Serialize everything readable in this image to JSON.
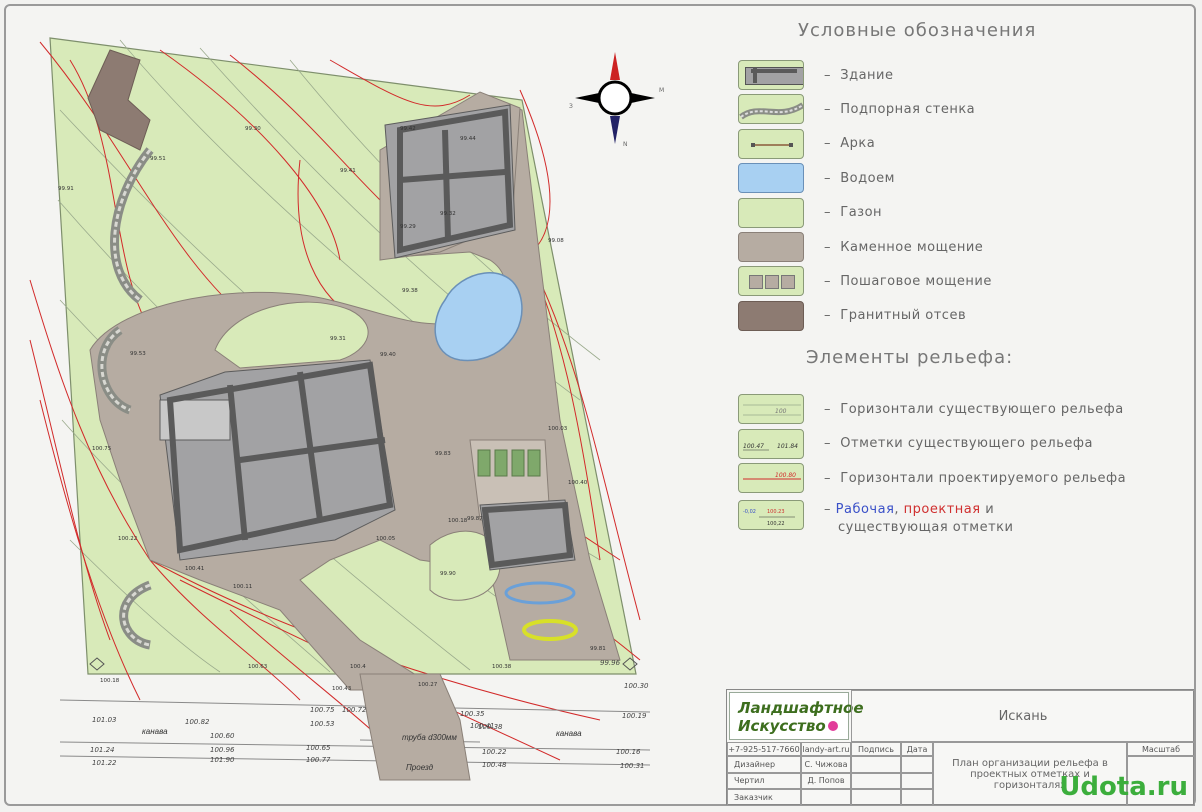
{
  "legend": {
    "title": "Условные обозначения",
    "items": [
      {
        "label": "Здание",
        "swatch": "building"
      },
      {
        "label": "Подпорная стенка",
        "swatch": "wall"
      },
      {
        "label": "Арка",
        "swatch": "arch"
      },
      {
        "label": "Водоем",
        "swatch": "pond"
      },
      {
        "label": "Газон",
        "swatch": "lawn"
      },
      {
        "label": "Каменное мощение",
        "swatch": "stone"
      },
      {
        "label": "Пошаговое мощение",
        "swatch": "steps"
      },
      {
        "label": "Гранитный отсев",
        "swatch": "granite"
      }
    ]
  },
  "relief": {
    "title": "Элементы рельефа:",
    "items": [
      {
        "label": "Горизонтали существующего рельефа",
        "swatch_text": "100"
      },
      {
        "label": "Отметки существующего рельефа",
        "swatch_text_left": "100.47",
        "swatch_text_right": "101.84"
      },
      {
        "label": "Горизонтали проектируемого рельефа",
        "swatch_text": "100.80"
      }
    ],
    "last": {
      "blue": "Рабочая",
      "sep1": ",",
      "red": "проектная",
      "sep2": "и",
      "line2": "существующая отметки",
      "swatch_work": "-0,02",
      "swatch_proj": "100.23",
      "swatch_exist": "100,22"
    }
  },
  "compass": {
    "e": "M",
    "w": "З",
    "s": "N"
  },
  "plan_labels": {
    "kanava_left": "канава",
    "kanava_right": "канава",
    "truba": "труба d300мм",
    "proezd": "Проезд",
    "road_nums": [
      "101.03",
      "100.82",
      "100.53",
      "100.75",
      "100.60",
      "100.35",
      "100.41",
      "100.19",
      "101.24",
      "100.96",
      "100.65",
      "100.22",
      "100.16",
      "101.22",
      "101.90",
      "100.77",
      "100.48",
      "100.31",
      "100.38",
      "100.72",
      "100.30",
      "99.96"
    ],
    "spot_levels": [
      "99.51",
      "99.30",
      "99.42",
      "99.44",
      "99.32",
      "99.29",
      "99.41",
      "99.38",
      "99.31",
      "99.40",
      "99.08",
      "99.53",
      "99.91",
      "100.75",
      "100.22",
      "100.41",
      "100.11",
      "100.05",
      "100.18",
      "100.03",
      "100.40",
      "99.83",
      "99.87",
      "99.90",
      "100.63",
      "100.4",
      "100.43",
      "100.27",
      "100.38",
      "99.81",
      "100.18"
    ]
  },
  "titleblock": {
    "company_line1": "Ландшафтное",
    "company_line2": "Искусство",
    "phone": "+7-925-517-7660",
    "site": "landy-art.ru",
    "col_sign": "Подпись",
    "col_date": "Дата",
    "project": "Искань",
    "sheet_title": "План организации рельефа в проектных отметках и горизонталях",
    "scale_label": "Масштаб",
    "rows": [
      {
        "role": "Дизайнер",
        "name": "С. Чижова"
      },
      {
        "role": "Чертил",
        "name": "Д. Попов"
      },
      {
        "role": "Заказчик",
        "name": ""
      }
    ]
  },
  "watermark": "Udota.ru",
  "colors": {
    "lawn": "#d8eab9",
    "building": "#a2a2a4",
    "stone": "#b6aca2",
    "granite": "#8d7b72",
    "pond": "#a8d0f2",
    "contour_red": "#d22a2a"
  }
}
